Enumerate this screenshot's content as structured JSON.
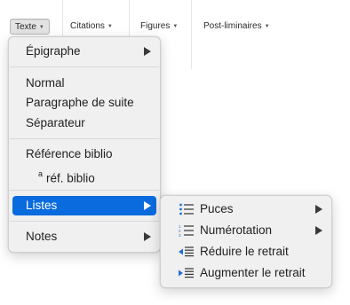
{
  "toolbar": {
    "tabs": [
      {
        "label": "Texte"
      },
      {
        "label": "Citations"
      },
      {
        "label": "Figures"
      },
      {
        "label": "Post-liminaires"
      }
    ]
  },
  "menu": {
    "items": [
      {
        "label": "Épigraphe",
        "submenu_arrow": true
      },
      {
        "label": "Normal"
      },
      {
        "label": "Paragraphe de suite"
      },
      {
        "label": "Séparateur"
      },
      {
        "label": "Référence biblio"
      },
      {
        "label": "réf. biblio",
        "prefix": "a"
      },
      {
        "label": "Listes",
        "submenu_arrow": true,
        "selected": true
      },
      {
        "label": "Notes",
        "submenu_arrow": true
      }
    ]
  },
  "submenu": {
    "items": [
      {
        "label": "Puces",
        "icon": "bullet-list-icon",
        "submenu_arrow": true
      },
      {
        "label": "Numérotation",
        "icon": "numbered-list-icon",
        "submenu_arrow": true
      },
      {
        "label": "Réduire le retrait",
        "icon": "outdent-icon"
      },
      {
        "label": "Augmenter le retrait",
        "icon": "indent-icon"
      }
    ]
  },
  "colors": {
    "selection": "#0a6bde",
    "icon_blue": "#1f6fd6"
  }
}
